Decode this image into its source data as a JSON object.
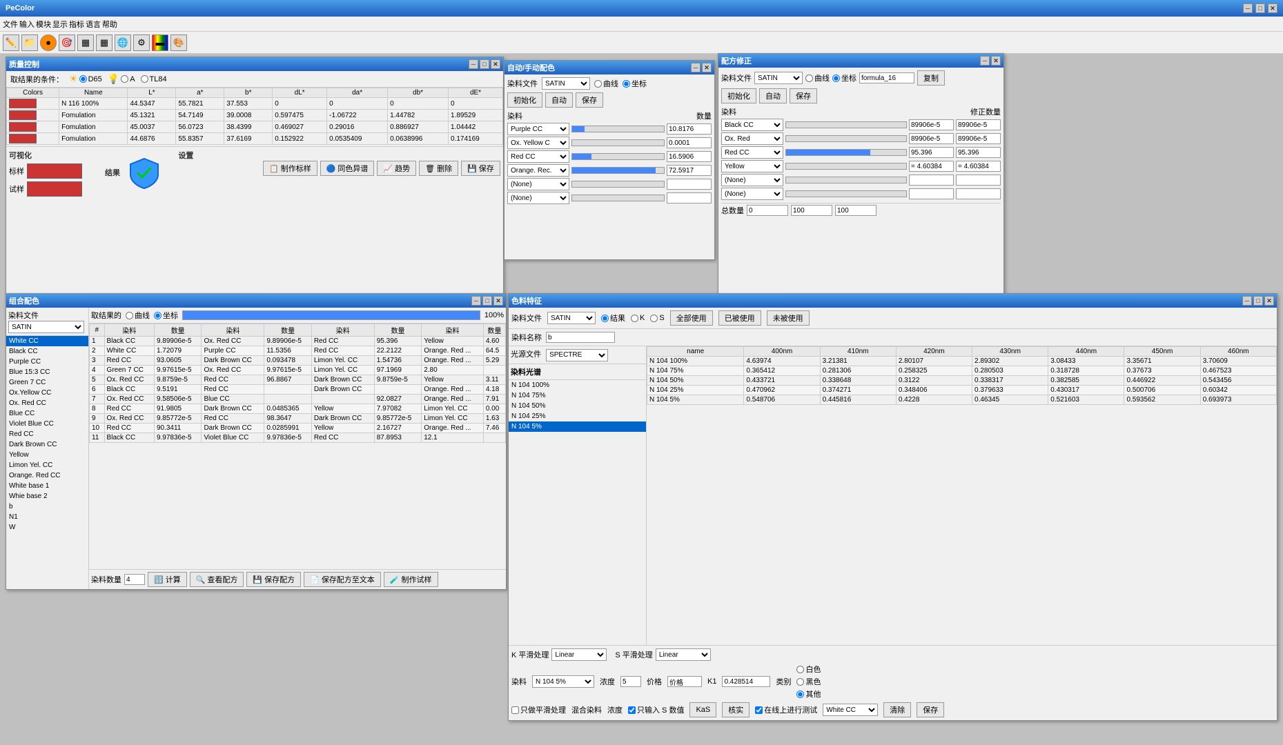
{
  "app": {
    "title": "PeColor",
    "menu": [
      "文件",
      "输入",
      "模块",
      "显示",
      "指标",
      "语言",
      "帮助"
    ]
  },
  "quality_window": {
    "title": "质量控制",
    "condition_label": "取结果的条件：",
    "light_d65": "D65",
    "light_a": "A",
    "light_tl84": "TL84",
    "columns": [
      "Colors",
      "Name",
      "L*",
      "a*",
      "b*",
      "dL*",
      "da*",
      "db*",
      "dE*"
    ],
    "rows": [
      {
        "color": "#cc3333",
        "name": "N 116 100%",
        "L": "44.5347",
        "a": "55.7821",
        "b": "37.553",
        "dL": "0",
        "da": "0",
        "db": "0",
        "dE": "0"
      },
      {
        "color": "#cc3333",
        "name": "Fomulation",
        "L": "45.1321",
        "a": "54.7149",
        "b": "39.0008",
        "dL": "0.597475",
        "da": "-1.06722",
        "db": "1.44782",
        "dE": "1.89529"
      },
      {
        "color": "#cc3333",
        "name": "Fomulation",
        "L": "45.0037",
        "a": "56.0723",
        "b": "38.4399",
        "dL": "0.469027",
        "da": "0.29016",
        "db": "0.886927",
        "dE": "1.04442"
      },
      {
        "color": "#cc3333",
        "name": "Fomulation",
        "L": "44.6876",
        "a": "55.8357",
        "b": "37.6169",
        "dL": "0.152922",
        "da": "0.0535409",
        "db": "0.0638996",
        "dE": "0.174169"
      }
    ],
    "sections": {
      "visualize": "可视化",
      "results": "结果",
      "settings": "设置",
      "sample_label": "标样",
      "trial_label": "试样"
    },
    "buttons": {
      "make_standard": "制作标样",
      "color_diff": "同色异谱",
      "trend": "趋势",
      "delete": "删除",
      "save": "保存"
    }
  },
  "auto_match_window": {
    "title": "自动/手动配色",
    "dye_file_label": "染料文件",
    "dye_file_value": "SATIN",
    "curve_label": "曲线",
    "standard_label": "坐标",
    "buttons": {
      "init": "初始化",
      "auto": "自动",
      "save": "保存"
    },
    "dye_label": "染料",
    "qty_label": "数量",
    "dyes": [
      {
        "name": "Purple CC",
        "qty": "10.8176"
      },
      {
        "name": "Ox. Yellow C",
        "qty": "0.0001"
      },
      {
        "name": "Red CC",
        "qty": "16.5906"
      },
      {
        "name": "Orange. Rec.",
        "qty": "72.5917"
      },
      {
        "name": "(None)",
        "qty": ""
      },
      {
        "name": "(None)",
        "qty": ""
      }
    ]
  },
  "formula_correct_window": {
    "title": "配方修正",
    "dye_file_label": "染料文件",
    "dye_file_value": "SATIN",
    "curve_label": "曲线",
    "standard_label": "坐标",
    "formula_name": "formula_16",
    "buttons": {
      "copy": "复制",
      "init": "初始化",
      "auto": "自动",
      "save": "保存"
    },
    "dye_label": "染料",
    "correct_qty_label": "修正数量",
    "dyes": [
      {
        "name": "Black CC",
        "val1": "89906e-5",
        "val2": "89906e-5"
      },
      {
        "name": "Ox. Red",
        "val1": "89906e-5",
        "val2": "89906e-5"
      },
      {
        "name": "Red CC",
        "val1": "95.396",
        "val2": "95.396"
      },
      {
        "name": "Yellow",
        "val1": "= 4.60384",
        "val2": "= 4.60384"
      },
      {
        "name": "(None)",
        "val1": "",
        "val2": ""
      },
      {
        "name": "(None)",
        "val1": "",
        "val2": ""
      }
    ],
    "total_qty_label": "总数量",
    "total_vals": [
      "0",
      "100",
      "100"
    ]
  },
  "combo_match_window": {
    "title": "组合配色",
    "dye_file_label": "染料文件",
    "dye_file_value": "SATIN",
    "fetch_result": "取结果的",
    "curve_label": "曲线",
    "standard_label": "坐标",
    "progress": "100%",
    "col_headers": [
      "染料",
      "数量",
      "染料",
      "数量",
      "染料",
      "数量",
      "染料",
      "数量"
    ],
    "rows": [
      {
        "num": "1",
        "d1": "Black CC",
        "q1": "9.89906e-5",
        "d2": "Ox. Red CC",
        "q2": "9.89906e-5",
        "d3": "Red CC",
        "q3": "95.396",
        "d4": "Yellow",
        "q4": "4.60"
      },
      {
        "num": "2",
        "d1": "White CC",
        "q1": "1.72079",
        "d2": "Purple CC",
        "q2": "11.5356",
        "d3": "Red CC",
        "q3": "22.2122",
        "d4": "Orange. Red ...",
        "q4": "64.5"
      },
      {
        "num": "3",
        "d1": "Red CC",
        "q1": "93.0605",
        "d2": "Dark Brown CC",
        "q2": "0.093478",
        "d3": "Limon Yel. CC",
        "q3": "1.54736",
        "d4": "Orange. Red ...",
        "q4": "5.29"
      },
      {
        "num": "4",
        "d1": "Green 7 CC",
        "q1": "9.97615e-5",
        "d2": "Ox. Red CC",
        "q2": "9.97615e-5",
        "d3": "Limon Yel. CC",
        "q3": "97.1969",
        "d4": "2.80"
      },
      {
        "num": "5",
        "d1": "Ox. Red CC",
        "q1": "9.8759e-5",
        "d2": "Red CC",
        "q2": "96.8867",
        "d3": "Dark Brown CC",
        "q3": "9.8759e-5",
        "d4": "Yellow",
        "q4": "3.11"
      },
      {
        "num": "6",
        "d1": "Black CC",
        "q1": "9.5191",
        "d2": "Red CC",
        "q2": "",
        "d3": "Dark Brown CC",
        "q3": "",
        "d4": "Orange. Red ...",
        "q4": "4.18"
      },
      {
        "num": "7",
        "d1": "Ox. Red CC",
        "q1": "9.58506e-5",
        "d2": "Blue CC",
        "q2": "",
        "d3": "",
        "q3": "92.0827",
        "d4": "Orange. Red ...",
        "q4": "7.91"
      },
      {
        "num": "8",
        "d1": "Red CC",
        "q1": "91.9805",
        "d2": "Dark Brown CC",
        "q2": "0.0485365",
        "d3": "Yellow",
        "q3": "7.97082",
        "d4": "Limon Yel. CC",
        "q4": "0.00"
      },
      {
        "num": "9",
        "d1": "Ox. Red CC",
        "q1": "9.85772e-5",
        "d2": "Red CC",
        "q2": "98.3647",
        "d3": "Dark Brown CC",
        "q3": "9.85772e-5",
        "d4": "Limon Yel. CC",
        "q4": "1.63"
      },
      {
        "num": "10",
        "d1": "Red CC",
        "q1": "90.3411",
        "d2": "Dark Brown CC",
        "q2": "0.0285991",
        "d3": "Yellow",
        "q3": "2.16727",
        "d4": "Orange. Red ...",
        "q4": "7.46"
      },
      {
        "num": "11",
        "d1": "Black CC",
        "q1": "9.97836e-5",
        "d2": "Violet Blue CC",
        "q2": "9.97836e-5",
        "d3": "Red CC",
        "q3": "87.8953",
        "d4": "12.1"
      }
    ],
    "dye_list": [
      "White CC",
      "Black CC",
      "Purple CC",
      "Blue 15:3 CC",
      "Green 7 CC",
      "Ox.Yellow CC",
      "Ox. Red CC",
      "Blue CC",
      "Violet Blue CC",
      "Red CC",
      "Dark Brown CC",
      "Yellow",
      "Limon Yel. CC",
      "Orange. Red CC",
      "White base 1",
      "Whie base 2",
      "b",
      "N1",
      "W"
    ],
    "selected_dye": "White CC",
    "buttons": {
      "dye_count": "染料数量",
      "calc": "计算",
      "view_formula": "查看配方",
      "save_formula": "保存配方",
      "save_formula_text": "保存配方至文本",
      "make_trial": "制作试样"
    },
    "dye_count_val": "4"
  },
  "dye_char_window": {
    "title": "色料特征",
    "dye_file_label": "染料文件",
    "dye_file_value": "SATIN",
    "result_label": "结果",
    "k_label": "K",
    "s_label": "S",
    "all_use": "全部使用",
    "used": "已被使用",
    "not_used": "未被使用",
    "dye_name_label": "染料名称",
    "dye_name_filter": "b",
    "light_file_label": "光源文件",
    "light_file_value": "SPECTRE",
    "dye_spectrum_label": "染料光谱",
    "spectrum_rows": [
      {
        "name": "N 104 100%",
        "selected": false
      },
      {
        "name": "N 104 75%",
        "selected": false
      },
      {
        "name": "N 104 50%",
        "selected": false
      },
      {
        "name": "N 104 25%",
        "selected": false
      },
      {
        "name": "N 104 5%",
        "selected": true
      }
    ],
    "col_headers": [
      "name",
      "400nm",
      "410nm",
      "420nm",
      "430nm",
      "440nm",
      "450nm",
      "460n"
    ],
    "data_rows": [
      {
        "name": "N 104 100%",
        "v400": "4.63974",
        "v410": "3.21381",
        "v420": "2.80107",
        "v430": "2.89302",
        "v440": "3.08433",
        "v450": "3.35671",
        "v460": "3.70609"
      },
      {
        "name": "N 104 75%",
        "v400": "0.365412",
        "v410": "0.281306",
        "v420": "0.258325",
        "v430": "0.280503",
        "v440": "0.318728",
        "v450": "0.37673",
        "v460": "0.467523"
      },
      {
        "name": "N 104 50%",
        "v400": "0.433721",
        "v410": "0.338648",
        "v420": "0.3122",
        "v430": "0.338317",
        "v440": "0.382585",
        "v450": "0.446922",
        "v460": "0.543456"
      },
      {
        "name": "N 104 25%",
        "v400": "0.470962",
        "v410": "0.374271",
        "v420": "0.348406",
        "v430": "0.379633",
        "v440": "0.430317",
        "v450": "0.500706",
        "v460": "0.60342"
      },
      {
        "name": "N 104 5%",
        "v400": "0.548706",
        "v410": "0.445816",
        "v420": "0.4228",
        "v430": "0.46345",
        "v440": "0.521603",
        "v450": "0.593562",
        "v460": "0.693973"
      }
    ],
    "smooth_k_label": "K 平滑处理",
    "smooth_k_val": "Linear",
    "smooth_s_label": "S 平滑处理",
    "smooth_s_val": "Linear",
    "dye_label": "染料",
    "conc_label": "浓度",
    "price_label": "价格",
    "k1_label": "K1",
    "type_label": "类别",
    "dye_sel": "N 104 5%",
    "conc_val": "5",
    "price_val": "价格",
    "k1_val": "0.428514",
    "only_smooth_label": "只做平滑处理",
    "only_s_label": "只输入 S 数值",
    "online_test_label": "在线上进行测试",
    "mix_label": "混合染料",
    "conc2_label": "浓度",
    "kas_label": "KaS",
    "verify_label": "核实",
    "white_cc_val": "White CC",
    "clear_label": "清除",
    "save_label": "保存",
    "white_radio": "白色",
    "black_radio": "黑色",
    "other_radio": "其他",
    "selected_radio": "other"
  }
}
